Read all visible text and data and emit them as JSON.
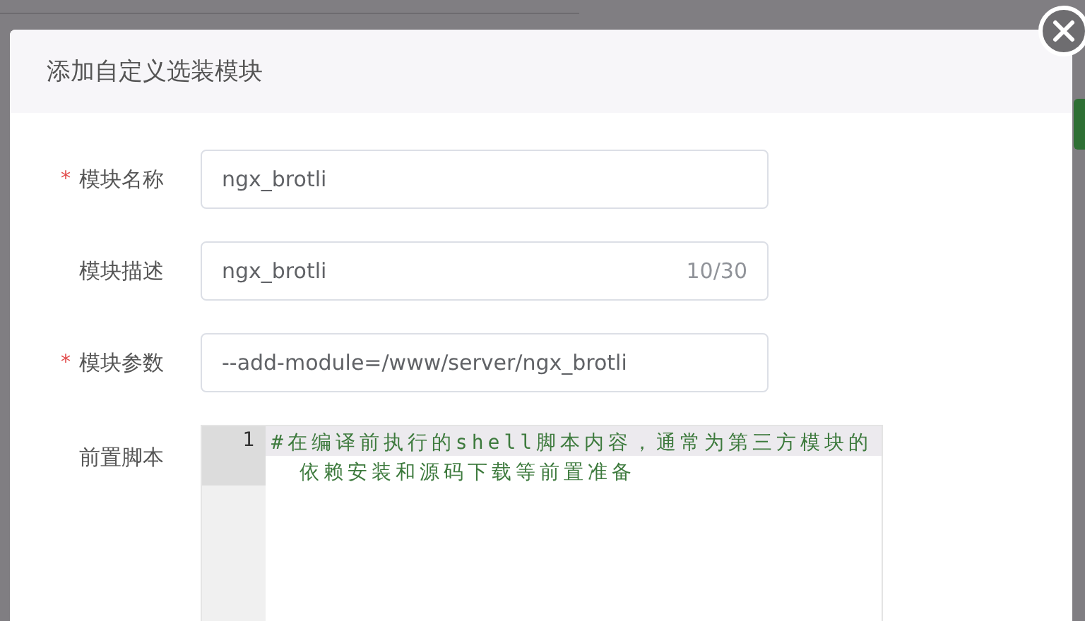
{
  "dialog": {
    "title": "添加自定义选装模块"
  },
  "fields": [
    {
      "kind": "input",
      "required_mark": "*",
      "label": "模块名称",
      "value": "ngx_brotli"
    },
    {
      "kind": "input",
      "label": "模块描述",
      "value": "ngx_brotli",
      "counter": "10/30"
    },
    {
      "kind": "input",
      "required_mark": "*",
      "label": "模块参数",
      "value": "--add-module=/www/server/ngx_brotli"
    },
    {
      "kind": "editor",
      "label": "前置脚本",
      "lines": [
        {
          "number": "1",
          "text": "#在编译前执行的shell脚本内容，通常为第三方模块的依赖安装和源码下载等前置准备",
          "selected": true
        }
      ]
    }
  ]
}
